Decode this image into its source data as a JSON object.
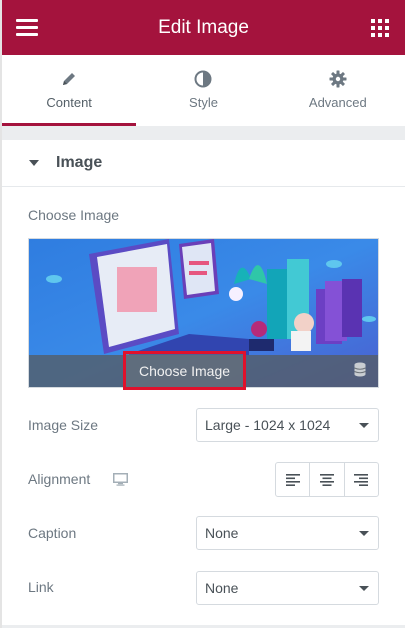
{
  "header": {
    "title": "Edit Image"
  },
  "tabs": [
    {
      "label": "Content",
      "icon": "pencil-icon",
      "active": true
    },
    {
      "label": "Style",
      "icon": "half-circle-icon",
      "active": false
    },
    {
      "label": "Advanced",
      "icon": "gear-icon",
      "active": false
    }
  ],
  "section": {
    "title": "Image"
  },
  "image_control": {
    "label": "Choose Image",
    "button_label": "Choose Image"
  },
  "image_size": {
    "label": "Image Size",
    "value": "Large - 1024 x 1024"
  },
  "alignment": {
    "label": "Alignment",
    "options": [
      "left",
      "center",
      "right"
    ]
  },
  "caption": {
    "label": "Caption",
    "value": "None"
  },
  "link": {
    "label": "Link",
    "value": "None"
  },
  "colors": {
    "accent": "#a4133d",
    "highlight_border": "#e0112c",
    "text": "#6d7882"
  }
}
